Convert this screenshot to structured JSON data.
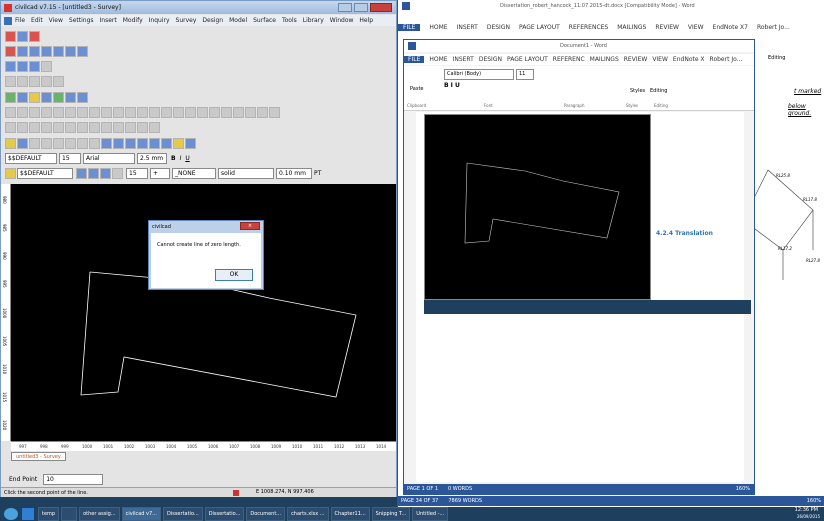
{
  "civilcad": {
    "title": "civilcad v7.15 - [untitled3 - Survey]",
    "menu": [
      "File",
      "Edit",
      "View",
      "Settings",
      "Insert",
      "Modify",
      "Inquiry",
      "Survey",
      "Design",
      "Model",
      "Surface",
      "Tools",
      "Library",
      "Window",
      "Help"
    ],
    "layer": "$$DEFAULT",
    "layer_num": "15",
    "font": "Arial",
    "text_size": "2.5 mm",
    "bold": "B",
    "italic": "I",
    "underline": "U",
    "layer2": "$$DEFAULT",
    "num2": "15",
    "plus": "+",
    "none": "_NONE",
    "linetype": "solid",
    "lineweight": "0.10 mm",
    "pt": "PT",
    "tab": "untitled3 - Survey",
    "prompt_label": "End Point",
    "prompt_value": "10",
    "status_text": "Click the second point of the line.",
    "coords": "E 1008.274, N 997.406",
    "ruler_left": [
      "980",
      "985",
      "990",
      "995",
      "1000",
      "1005",
      "1010",
      "1015",
      "1020"
    ],
    "ruler_bottom": [
      "997",
      "998",
      "999",
      "1000",
      "1001",
      "1002",
      "1003",
      "1004",
      "1005",
      "1006",
      "1007",
      "1008",
      "1009",
      "1010",
      "1011",
      "1012",
      "1013",
      "1014"
    ]
  },
  "dialog": {
    "title": "civilcad",
    "message": "Cannot create line of zero length.",
    "ok": "OK"
  },
  "word_back": {
    "title": "Dissertation_robert_hancock_11.07.2015-dt.docx [Compatibility Mode] - Word",
    "tabs": [
      "FILE",
      "HOME",
      "INSERT",
      "DESIGN",
      "PAGE LAYOUT",
      "REFERENCES",
      "MAILINGS",
      "REVIEW",
      "VIEW",
      "EndNote X7"
    ],
    "user": "Robert Jo...",
    "editing": "Editing",
    "doc_text1": "t marked",
    "doc_text2": "below ground.",
    "status_page": "PAGE 34 OF 37",
    "status_words": "7869 WORDS",
    "zoom": "160%",
    "labels": [
      "RL25.8",
      "RL17.8",
      "RL17.2",
      "RL27.8"
    ]
  },
  "word_front": {
    "title": "Document1 - Word",
    "tabs": [
      "FILE",
      "HOME",
      "INSERT",
      "DESIGN",
      "PAGE LAYOUT",
      "REFERENC",
      "MAILINGS",
      "REVIEW",
      "VIEW",
      "EndNote X"
    ],
    "user": "Robert Jo...",
    "font": "Calibri (Body)",
    "size": "11",
    "groups": [
      "Clipboard",
      "Font",
      "Paragraph",
      "Styles",
      "Editing"
    ],
    "paste": "Paste",
    "styles": "Styles",
    "editing": "Editing",
    "heading": "4.2.4 Translation",
    "status_page": "PAGE 1 OF 1",
    "status_words": "0 WORDS",
    "zoom": "160%"
  },
  "taskbar": {
    "items": [
      "temp",
      "",
      "other assig...",
      "civilcad v7...",
      "Dissertatio...",
      "Dissertatio...",
      "Document...",
      "charts.xlsx ...",
      "Chapter11...",
      "Snipping T...",
      "Untitled -..."
    ],
    "time": "12:36 PM",
    "date": "26/09/2015"
  },
  "colors": {
    "accent_word": "#2b579a",
    "cad_bg": "#000000",
    "task_bg": "#1f3f5f"
  }
}
